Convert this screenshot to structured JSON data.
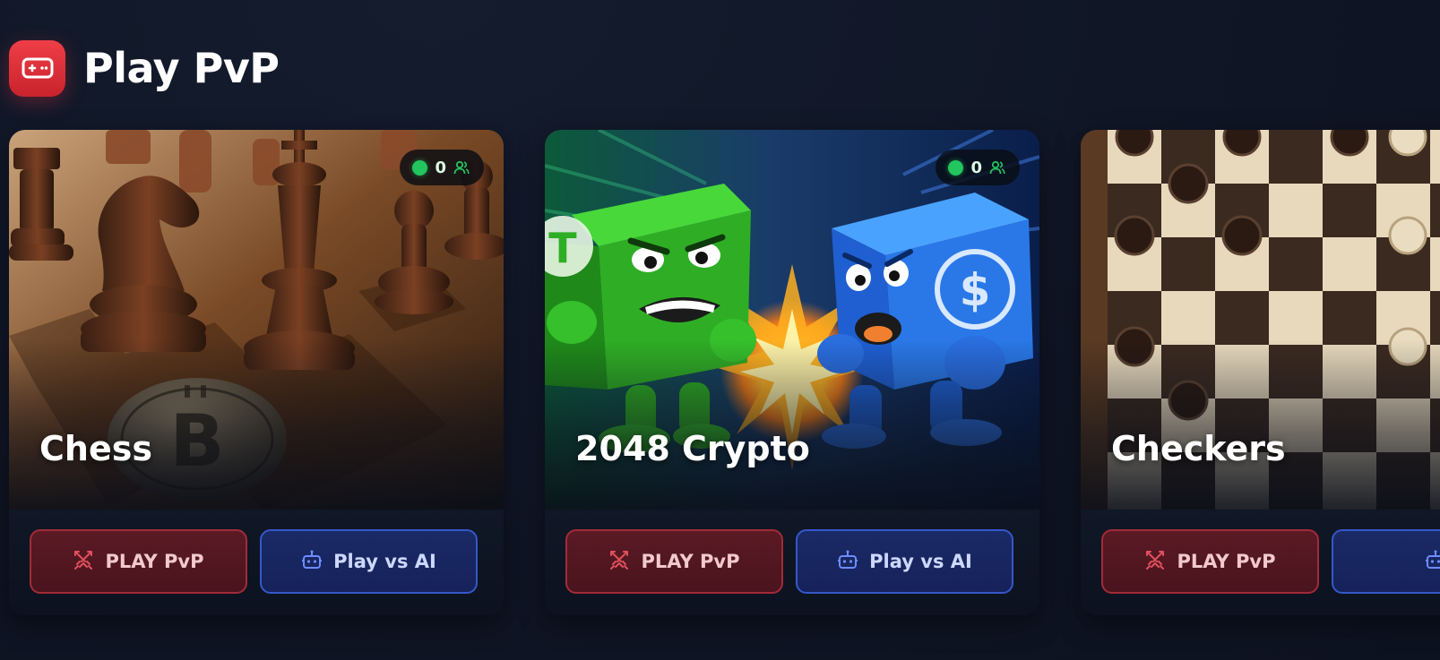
{
  "section": {
    "title": "Play PvP",
    "icon": "gamepad-icon",
    "accent_color": "#e3343d"
  },
  "games": [
    {
      "title": "Chess",
      "online_count": "0",
      "online_icon": "users-icon",
      "status_color": "#22c55e",
      "pvp_label": "PLAY PvP",
      "pvp_icon": "crossed-swords-icon",
      "ai_label": "Play vs AI",
      "ai_icon": "robot-icon"
    },
    {
      "title": "2048 Crypto",
      "online_count": "0",
      "online_icon": "users-icon",
      "status_color": "#22c55e",
      "pvp_label": "PLAY PvP",
      "pvp_icon": "crossed-swords-icon",
      "ai_label": "Play vs AI",
      "ai_icon": "robot-icon"
    },
    {
      "title": "Checkers",
      "online_count": "",
      "pvp_label": "PLAY PvP",
      "pvp_icon": "crossed-swords-icon",
      "ai_label": "",
      "ai_icon": "robot-icon"
    }
  ],
  "colors": {
    "background": "#0f1524",
    "pvp_button": "#4a141d",
    "pvp_border": "#a32b38",
    "ai_button": "#16225a",
    "ai_border": "#3558c9"
  }
}
